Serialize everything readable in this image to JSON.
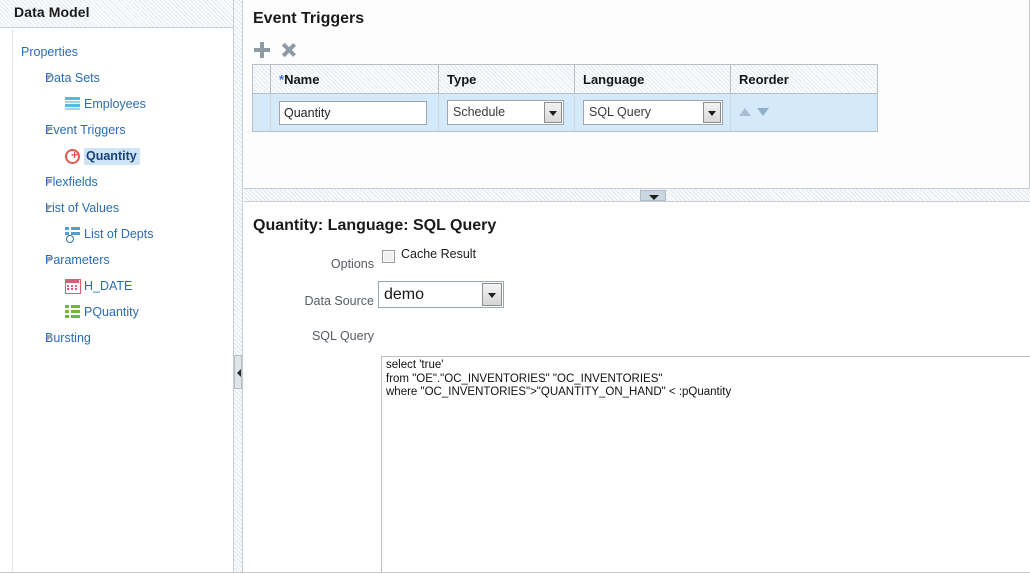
{
  "sidebar": {
    "title": "Data Model",
    "tree": [
      {
        "label": "Properties",
        "level": 0,
        "icon": null,
        "expander": false,
        "selected": false
      },
      {
        "label": "Data Sets",
        "level": 1,
        "icon": null,
        "expander": true,
        "selected": false
      },
      {
        "label": "Employees",
        "level": 2,
        "icon": "dataset-icon",
        "expander": false,
        "selected": false
      },
      {
        "label": "Event Triggers",
        "level": 1,
        "icon": null,
        "expander": true,
        "selected": false
      },
      {
        "label": "Quantity",
        "level": 2,
        "icon": "trigger-icon",
        "expander": false,
        "selected": true
      },
      {
        "label": "Flexfields",
        "level": 1,
        "icon": null,
        "expander": true,
        "selected": false
      },
      {
        "label": "List of Values",
        "level": 1,
        "icon": null,
        "expander": true,
        "selected": false
      },
      {
        "label": "List of Depts",
        "level": 2,
        "icon": "lov-icon",
        "expander": false,
        "selected": false
      },
      {
        "label": "Parameters",
        "level": 1,
        "icon": null,
        "expander": true,
        "selected": false
      },
      {
        "label": "H_DATE",
        "level": 2,
        "icon": "date-icon",
        "expander": false,
        "selected": false
      },
      {
        "label": "PQuantity",
        "level": 2,
        "icon": "param-icon",
        "expander": false,
        "selected": false
      },
      {
        "label": "Bursting",
        "level": 1,
        "icon": null,
        "expander": true,
        "selected": false
      }
    ]
  },
  "top_panel": {
    "title": "Event Triggers",
    "toolbar": {
      "add_icon": "plus-icon",
      "delete_icon": "x-icon"
    },
    "table": {
      "columns": [
        "*Name",
        "Type",
        "Language",
        "Reorder"
      ],
      "name_column_required_marker": "*",
      "name_column_label": "Name",
      "rows": [
        {
          "name": "Quantity",
          "type": "Schedule",
          "language": "SQL Query",
          "reorder_up_icon": "move-up-icon",
          "reorder_down_icon": "move-down-icon"
        }
      ],
      "type_options": [
        "Schedule"
      ],
      "language_options": [
        "SQL Query"
      ]
    }
  },
  "splitters": {
    "vertical_handle_icon": "collapse-left-icon",
    "horizontal_handle_icon": "collapse-down-icon"
  },
  "bottom_panel": {
    "title": "Quantity: Language: SQL Query",
    "fields": {
      "options_label": "Options",
      "cache_result_label": "Cache Result",
      "cache_result_checked": false,
      "data_source_label": "Data Source",
      "data_source_value": "demo",
      "data_source_options": [
        "demo"
      ],
      "sql_query_label": "SQL Query",
      "sql_query_value": "select 'true'\nfrom \"OE\".\"OC_INVENTORIES\" \"OC_INVENTORIES\"\nwhere \"OC_INVENTORIES\">\"QUANTITY_ON_HAND\" < :pQuantity"
    }
  },
  "colors": {
    "link": "#2a6cb5",
    "selected_row": "#d4e9f9",
    "selection_highlight": "#cfe4f7",
    "border": "#b6c0c9",
    "toolbar_icon": "#8e9aa4"
  }
}
